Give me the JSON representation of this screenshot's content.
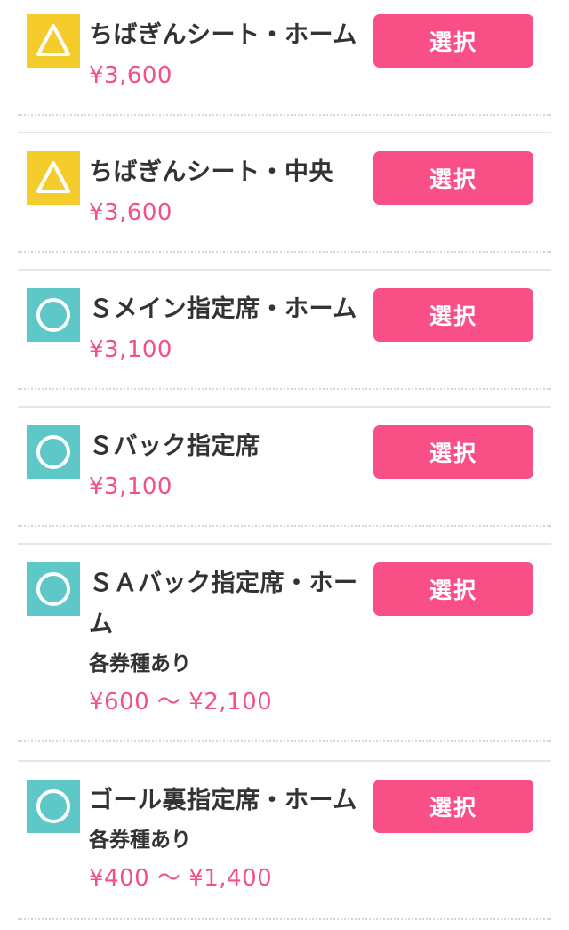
{
  "colors": {
    "accent": "#f74f86",
    "price": "#f2508a",
    "triangle_icon_bg": "#f4cd2d",
    "circle_icon_bg": "#5ec7c8"
  },
  "seats": [
    {
      "icon": "triangle-icon",
      "name": "ちばぎんシート・ホーム",
      "note": "",
      "price": "¥3,600",
      "button": "選択"
    },
    {
      "icon": "triangle-icon",
      "name": "ちばぎんシート・中央",
      "note": "",
      "price": "¥3,600",
      "button": "選択"
    },
    {
      "icon": "circle-icon",
      "name": "Ｓメイン指定席・ホーム",
      "note": "",
      "price": "¥3,100",
      "button": "選択"
    },
    {
      "icon": "circle-icon",
      "name": "Ｓバック指定席",
      "note": "",
      "price": "¥3,100",
      "button": "選択"
    },
    {
      "icon": "circle-icon",
      "name": "ＳＡバック指定席・ホーム",
      "note": "各券種あり",
      "price": "¥600 ～ ¥2,100",
      "button": "選択"
    },
    {
      "icon": "circle-icon",
      "name": "ゴール裏指定席・ホーム",
      "note": "各券種あり",
      "price": "¥400 ～ ¥1,400",
      "button": "選択"
    }
  ]
}
